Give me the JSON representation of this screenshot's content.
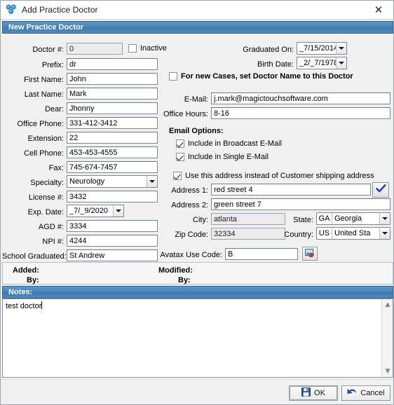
{
  "window": {
    "title": "Add Practice Doctor",
    "icon": "molecule-people-icon",
    "close_label": "✕"
  },
  "section": {
    "header": "New Practice Doctor"
  },
  "left_fields": {
    "doctor_no": {
      "label": "Doctor #:",
      "value": "0"
    },
    "inactive": {
      "label": "Inactive",
      "checked": false
    },
    "prefix": {
      "label": "Prefix:",
      "value": "dr"
    },
    "first_name": {
      "label": "First Name:",
      "value": "John"
    },
    "last_name": {
      "label": "Last Name:",
      "value": "Mark"
    },
    "dear": {
      "label": "Dear:",
      "value": "Jhonny"
    },
    "office_phone": {
      "label": "Office Phone:",
      "value": "331-412-3412"
    },
    "extension": {
      "label": "Extension:",
      "value": "22"
    },
    "cell_phone": {
      "label": "Cell Phone:",
      "value": "453-453-4555"
    },
    "fax": {
      "label": "Fax:",
      "value": "745-674-7457"
    },
    "specialty": {
      "label": "Specialty:",
      "value": "Neurology"
    },
    "license_no": {
      "label": "License #:",
      "value": "3432"
    },
    "exp_date": {
      "label": "Exp. Date:",
      "value": "_7/_9/2020"
    },
    "agd_no": {
      "label": "AGD #:",
      "value": "3334"
    },
    "npi_no": {
      "label": "NPI #:",
      "value": "4244"
    },
    "school_graduated": {
      "label": "School Graduated:",
      "value": "St Andrew"
    }
  },
  "right_fields": {
    "graduated_on": {
      "label": "Graduated On:",
      "value": "_7/15/2014"
    },
    "birth_date": {
      "label": "Birth Date:",
      "value": "_2/_7/1978"
    },
    "set_doctor_name": {
      "label": "For new Cases, set Doctor Name to this Doctor",
      "checked": false
    },
    "email": {
      "label": "E-Mail:",
      "value": "j.mark@magictouchsoftware.com"
    },
    "office_hours": {
      "label": "Office Hours:",
      "value": "8-16"
    }
  },
  "email_options": {
    "title": "Email Options:",
    "broadcast": {
      "label": "Include in Broadcast E-Mail",
      "checked": true
    },
    "single": {
      "label": "Include in Single E-Mail",
      "checked": true
    },
    "use_address": {
      "label": "Use this address instead of Customer shipping address",
      "checked": true
    }
  },
  "address": {
    "address1": {
      "label": "Address 1:",
      "value": "red street 4"
    },
    "address2": {
      "label": "Address 2:",
      "value": "green street 7"
    },
    "city": {
      "label": "City:",
      "value": "atlanta"
    },
    "zip": {
      "label": "Zip Code:",
      "value": "32334"
    },
    "state": {
      "label": "State:",
      "code": "GA",
      "name": "Georgia"
    },
    "country": {
      "label": "Country:",
      "code": "US",
      "name": "United Sta"
    },
    "verify_icon": "check-icon",
    "avatax": {
      "label": "Avatax Use Code:",
      "value": "B",
      "button_icon": "picture-edit-icon"
    }
  },
  "audit": {
    "added_label": "Added:",
    "added_value": "",
    "added_by_label": "By:",
    "added_by_value": "",
    "modified_label": "Modified:",
    "modified_value": "",
    "modified_by_label": "By:",
    "modified_by_value": ""
  },
  "notes": {
    "header": "Notes:",
    "value": "test doctor"
  },
  "footer": {
    "ok_label": "OK",
    "ok_icon": "save-disk-icon",
    "cancel_label": "Cancel",
    "cancel_icon": "undo-arrow-icon"
  },
  "colors": {
    "header_blue": "#4a85ba",
    "window_bg": "#f0f0f0",
    "field_bg": "#ffffff",
    "accent_blue": "#2b55c0"
  }
}
